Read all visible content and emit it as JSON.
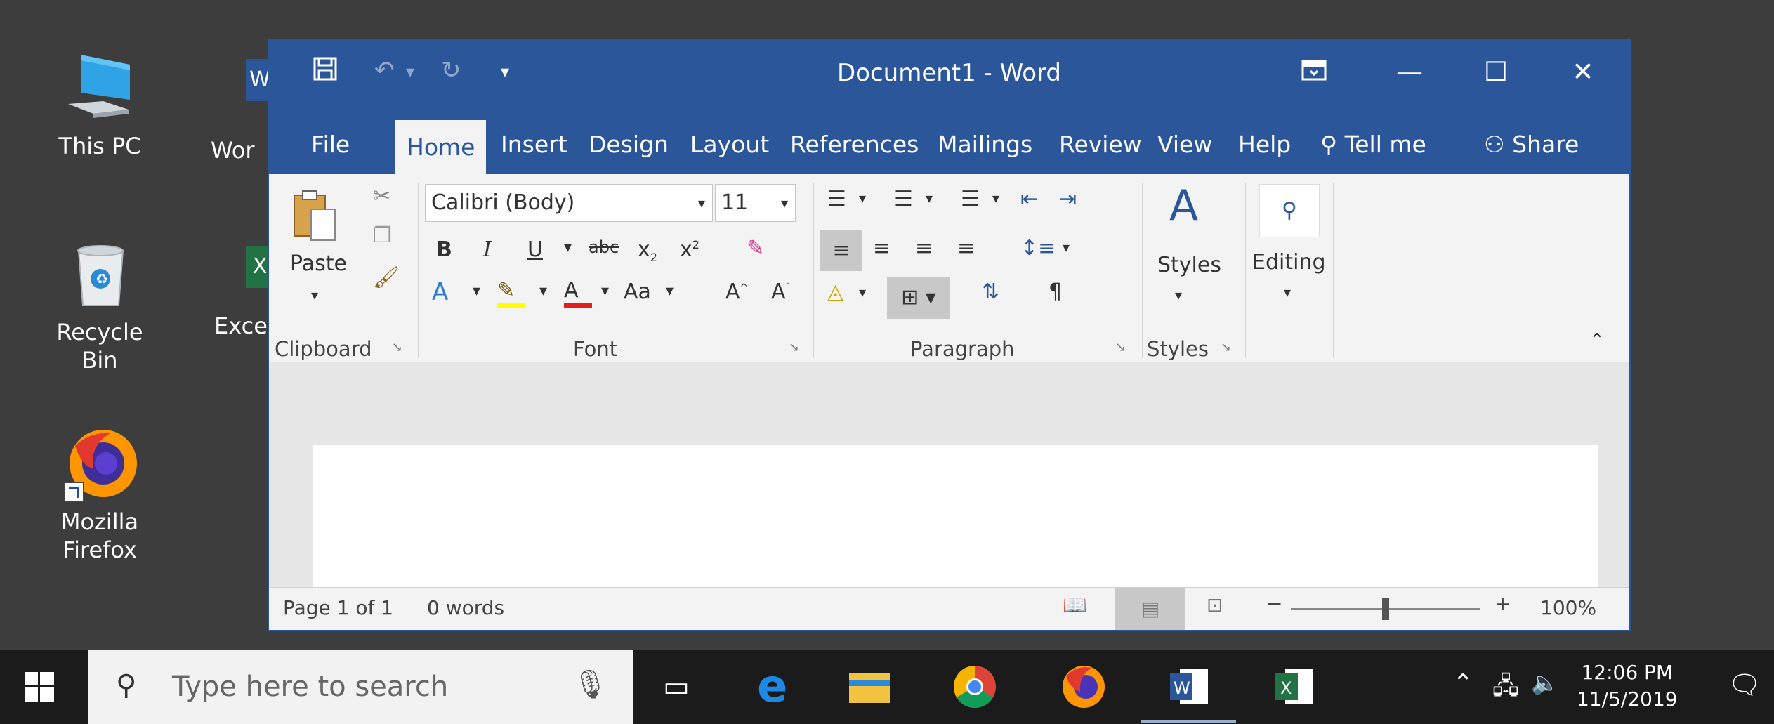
{
  "desktop": {
    "icons": [
      {
        "label": "This PC"
      },
      {
        "label": "Recycle Bin"
      },
      {
        "label_line1": "Mozilla",
        "label_line2": "Firefox"
      },
      {
        "label": "Wor"
      },
      {
        "label": "Exce"
      }
    ]
  },
  "word": {
    "title": "Document1  -  Word",
    "tabs": [
      "File",
      "Home",
      "Insert",
      "Design",
      "Layout",
      "References",
      "Mailings",
      "Review",
      "View",
      "Help"
    ],
    "tell_me": "Tell me",
    "share": "Share",
    "font_name": "Calibri (Body)",
    "font_size": "11",
    "paste_label": "Paste",
    "styles_label": "Styles",
    "editing_label": "Editing",
    "group_clipboard": "Clipboard",
    "group_font": "Font",
    "group_paragraph": "Paragraph",
    "group_styles": "Styles",
    "status_page": "Page 1 of 1",
    "status_words": "0 words",
    "zoom": "100%",
    "zoom_value": 100
  },
  "taskbar": {
    "search_placeholder": "Type here to search",
    "time": "12:06 PM",
    "date": "11/5/2019"
  },
  "colors": {
    "word_blue": "#2b579a",
    "desktop": "#3d3d3d",
    "taskbar": "#1b1b1b"
  }
}
